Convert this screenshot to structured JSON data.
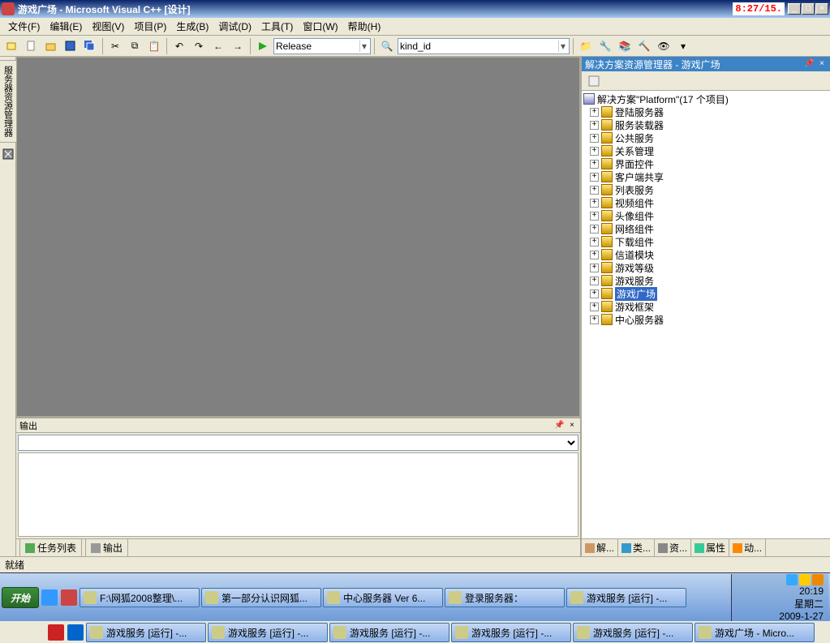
{
  "titlebar": {
    "text": "游戏广场  - Microsoft Visual C++ [设计]",
    "clock": "8:27/15."
  },
  "menu": [
    "文件(F)",
    "编辑(E)",
    "视图(V)",
    "项目(P)",
    "生成(B)",
    "调试(D)",
    "工具(T)",
    "窗口(W)",
    "帮助(H)"
  ],
  "toolbar": {
    "config": "Release",
    "find": "kind_id"
  },
  "left_vtab": "服务器资源管理器",
  "output": {
    "title": "输出"
  },
  "bottom_tabs": {
    "tasks": "任务列表",
    "output": "输出"
  },
  "solution_explorer": {
    "title": "解决方案资源管理器 - 游戏广场",
    "solution": "解决方案\"Platform\"(17 个项目)",
    "projects": [
      "登陆服务器",
      "服务装载器",
      "公共服务",
      "关系管理",
      "界面控件",
      "客户端共享",
      "列表服务",
      "视频组件",
      "头像组件",
      "网络组件",
      "下载组件",
      "信道模块",
      "游戏等级",
      "游戏服务",
      "游戏广场",
      "游戏框架",
      "中心服务器"
    ],
    "selected": "游戏广场"
  },
  "right_tabs": [
    "解...",
    "类...",
    "资...",
    "属性",
    "动..."
  ],
  "status": "就绪",
  "taskbar": {
    "start": "开始",
    "row1": [
      "F:\\网狐2008整理\\...",
      "第一部分认识网狐...",
      "中心服务器 Ver 6...",
      "登录服务器：",
      "游戏服务 [运行] -..."
    ],
    "row2": [
      "游戏服务 [运行] -...",
      "游戏服务 [运行] -...",
      "游戏服务 [运行] -...",
      "游戏服务 [运行] -...",
      "游戏服务 [运行] -..."
    ],
    "row3": [
      "",
      "",
      "游戏广场  - Micro..."
    ],
    "tray": {
      "time": "20:19",
      "day": "星期二",
      "date": "2009-1-27"
    }
  }
}
